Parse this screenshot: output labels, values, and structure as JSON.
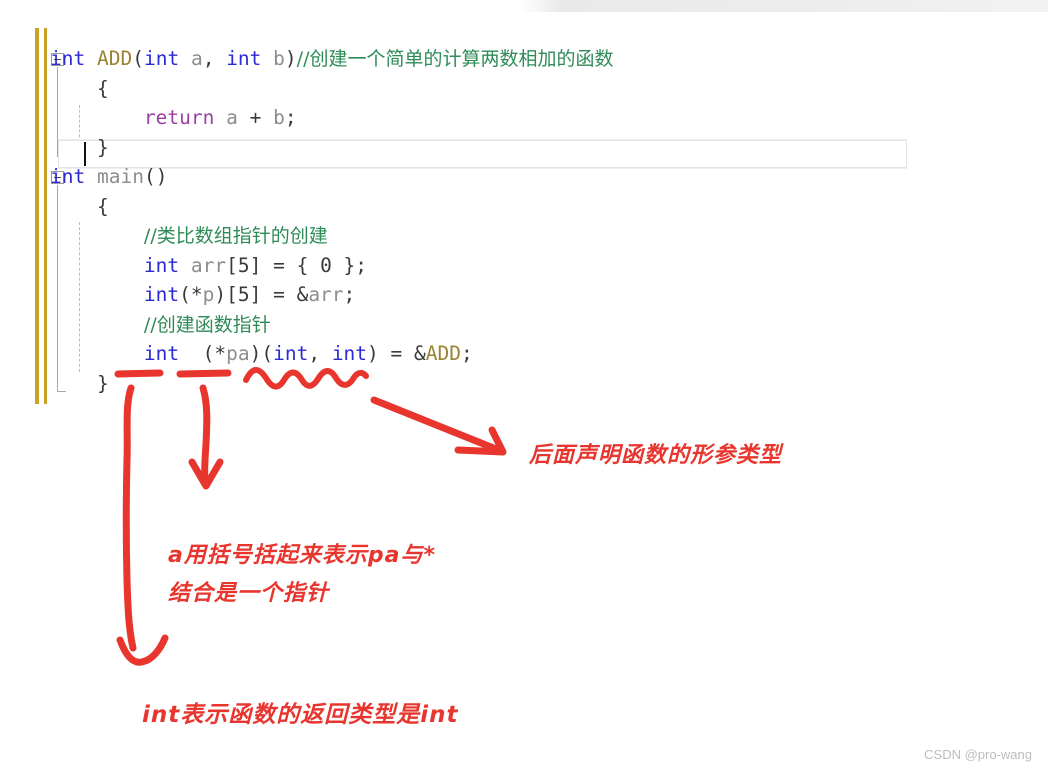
{
  "editor": {
    "language": "C",
    "code_lines": [
      {
        "indent": 0,
        "fold": true,
        "tokens": [
          {
            "t": "int",
            "c": "kw"
          },
          {
            "t": " ",
            "c": "pun"
          },
          {
            "t": "ADD",
            "c": "fn"
          },
          {
            "t": "(",
            "c": "pun"
          },
          {
            "t": "int",
            "c": "kw"
          },
          {
            "t": " ",
            "c": "pun"
          },
          {
            "t": "a",
            "c": "id"
          },
          {
            "t": ", ",
            "c": "pun"
          },
          {
            "t": "int",
            "c": "kw"
          },
          {
            "t": " ",
            "c": "pun"
          },
          {
            "t": "b",
            "c": "id"
          },
          {
            "t": ")",
            "c": "pun"
          },
          {
            "t": "//创建一个简单的计算两数相加的函数",
            "c": "cmt"
          }
        ],
        "plain": "int ADD(int a, int b)//创建一个简单的计算两数相加的函数"
      },
      {
        "indent": 1,
        "fold": false,
        "tokens": [
          {
            "t": "{",
            "c": "pun"
          }
        ],
        "plain": "{"
      },
      {
        "indent": 2,
        "fold": false,
        "tokens": [
          {
            "t": "return",
            "c": "ret"
          },
          {
            "t": " ",
            "c": "pun"
          },
          {
            "t": "a",
            "c": "id"
          },
          {
            "t": " + ",
            "c": "pun"
          },
          {
            "t": "b",
            "c": "id"
          },
          {
            "t": ";",
            "c": "pun"
          }
        ],
        "plain": "return a + b;"
      },
      {
        "indent": 1,
        "fold": false,
        "current": true,
        "tokens": [
          {
            "t": "}",
            "c": "pun"
          }
        ],
        "plain": "}"
      },
      {
        "indent": 0,
        "fold": true,
        "tokens": [
          {
            "t": "int",
            "c": "kw"
          },
          {
            "t": " ",
            "c": "pun"
          },
          {
            "t": "main",
            "c": "id"
          },
          {
            "t": "()",
            "c": "pun"
          }
        ],
        "plain": "int main()"
      },
      {
        "indent": 1,
        "fold": false,
        "tokens": [
          {
            "t": "{",
            "c": "pun"
          }
        ],
        "plain": "{"
      },
      {
        "indent": 2,
        "fold": false,
        "tokens": [
          {
            "t": "//类比数组指针的创建",
            "c": "cmt"
          }
        ],
        "plain": "//类比数组指针的创建"
      },
      {
        "indent": 2,
        "fold": false,
        "tokens": [
          {
            "t": "int",
            "c": "kw"
          },
          {
            "t": " ",
            "c": "pun"
          },
          {
            "t": "arr",
            "c": "id"
          },
          {
            "t": "[5] = { ",
            "c": "pun"
          },
          {
            "t": "0",
            "c": "num"
          },
          {
            "t": " };",
            "c": "pun"
          }
        ],
        "plain": "int arr[5] = { 0 };"
      },
      {
        "indent": 2,
        "fold": false,
        "tokens": [
          {
            "t": "int",
            "c": "kw"
          },
          {
            "t": "(*",
            "c": "pun"
          },
          {
            "t": "p",
            "c": "id"
          },
          {
            "t": ")[5] = &",
            "c": "pun"
          },
          {
            "t": "arr",
            "c": "id"
          },
          {
            "t": ";",
            "c": "pun"
          }
        ],
        "plain": "int(*p)[5] = &arr;"
      },
      {
        "indent": 2,
        "fold": false,
        "tokens": [
          {
            "t": "//创建函数指针",
            "c": "cmt"
          }
        ],
        "plain": "//创建函数指针"
      },
      {
        "indent": 2,
        "fold": false,
        "tokens": [
          {
            "t": "int",
            "c": "kw"
          },
          {
            "t": "  (*",
            "c": "pun"
          },
          {
            "t": "pa",
            "c": "id"
          },
          {
            "t": ")(",
            "c": "pun"
          },
          {
            "t": "int",
            "c": "kw"
          },
          {
            "t": ", ",
            "c": "pun"
          },
          {
            "t": "int",
            "c": "kw"
          },
          {
            "t": ") = &",
            "c": "pun"
          },
          {
            "t": "ADD",
            "c": "fn"
          },
          {
            "t": ";",
            "c": "pun"
          }
        ],
        "plain": "int  (*pa)(int, int) = &ADD;"
      },
      {
        "indent": 1,
        "fold": false,
        "tokens": [
          {
            "t": "}",
            "c": "pun"
          }
        ],
        "plain": "}"
      }
    ]
  },
  "annotations": {
    "ink_color": "#e8362f",
    "notes": [
      {
        "id": "param-types",
        "text": "后面声明函数的形参类型"
      },
      {
        "id": "paren-meaning-line1",
        "text": "a用括号括起来表示pa与*"
      },
      {
        "id": "paren-meaning-line2",
        "text": "结合是一个指针"
      },
      {
        "id": "return-type",
        "text": "int表示函数的返回类型是int"
      }
    ],
    "marks": [
      {
        "id": "underline-int",
        "shape": "underline",
        "target": "int"
      },
      {
        "id": "underline-pa",
        "shape": "underline",
        "target": "(*pa)"
      },
      {
        "id": "squiggle-params",
        "shape": "squiggle",
        "target": "(int, int)"
      },
      {
        "id": "arrow-to-param-note",
        "shape": "arrow",
        "target": "后面声明函数的形参类型"
      },
      {
        "id": "arrow-int-to-return-note",
        "shape": "arrow",
        "target": "int表示函数的返回类型是int"
      },
      {
        "id": "arrow-pa-to-paren-note",
        "shape": "arrow",
        "target": "a用括号括起来表示pa与*"
      }
    ]
  },
  "watermark": {
    "text": "CSDN @pro-wang"
  },
  "theme": {
    "keyword": "#2b2bd4",
    "function": "#9a8232",
    "identifier": "#8d8d8d",
    "comment": "#2e8b57",
    "return_keyword": "#9b3fa0",
    "change_bar": "#c9a227",
    "background": "#ffffff"
  }
}
